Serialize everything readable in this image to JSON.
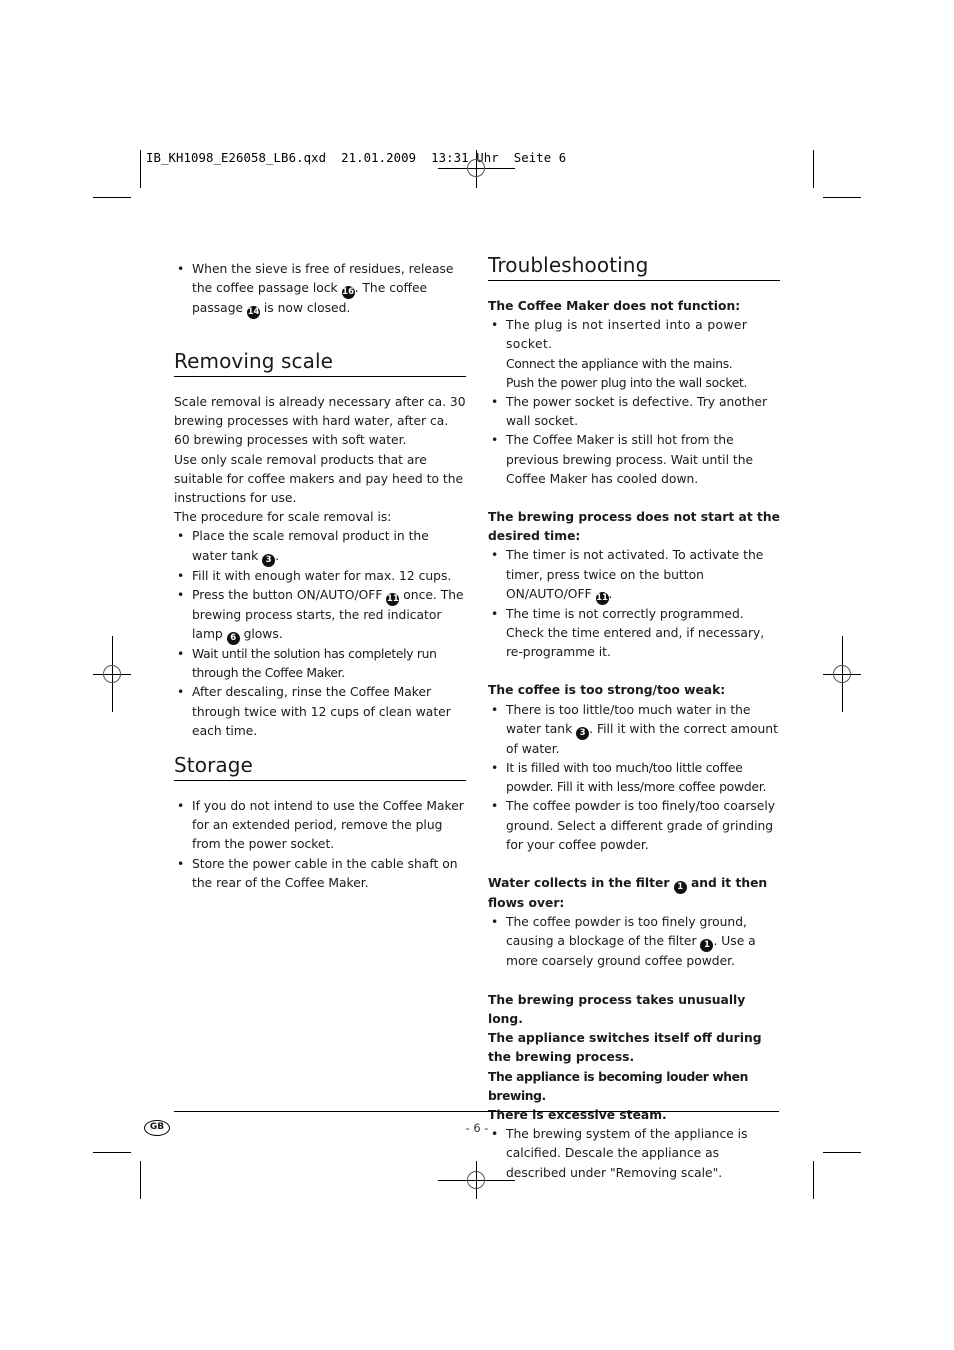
{
  "slug": {
    "file": "IB_KH1098_E26058_LB6.qxd",
    "date": "21.01.2009",
    "time": "13:31 Uhr",
    "page": "Seite 6"
  },
  "left_column": {
    "intro_bullet": {
      "t1": "When the sieve is free of residues, release the coffee passage lock ",
      "ref1": "16",
      "t2": ". The coffee passage ",
      "ref2": "14",
      "t3": " is now closed."
    },
    "removing_scale": {
      "heading": "Removing scale",
      "para1": "Scale removal is already necessary after ca. 30 brewing processes with hard water, after ca. 60 brewing processes with soft water.",
      "para2": "Use only scale removal products that are suitable for coffee makers and pay heed to the instructions for use.",
      "para3": "The procedure for scale removal is:",
      "b1_t1": "Place the scale removal product in the water tank ",
      "b1_ref": "3",
      "b1_t2": ".",
      "b2": "Fill it with enough water for max. 12 cups.",
      "b3_t1": "Press the button ON/AUTO/OFF ",
      "b3_ref": "11",
      "b3_t2": " once. The brewing process starts, the red indicator lamp ",
      "b3_ref2": "6",
      "b3_t3": " glows.",
      "b4": "Wait until the solution has completely run through the Coffee Maker.",
      "b5": "After descaling, rinse the Coffee Maker through twice with 12 cups of clean water each time."
    },
    "storage": {
      "heading": "Storage",
      "b1": "If you do not intend to use the Coffee Maker for an extended period, remove the plug from the power socket.",
      "b2": "Store the power cable in the cable shaft on the rear of the Coffee Maker."
    }
  },
  "right_column": {
    "heading": "Troubleshooting",
    "s1": {
      "title": "The Coffee Maker does not function:",
      "b1_l1": "The plug is not inserted into a power socket.",
      "b1_l2": "Connect the appliance with the mains.",
      "b1_l3": "Push the power plug into the wall socket.",
      "b2": "The power socket is defective. Try another wall socket.",
      "b3": "The Coffee Maker is still hot from the previous brewing process. Wait until the Coffee Maker has cooled down."
    },
    "s2": {
      "title": "The brewing process does not start at the desired time:",
      "b1_t1": "The timer is not activated. To activate the timer, press twice on the button ON/AUTO/OFF ",
      "b1_ref": "11",
      "b1_t2": ".",
      "b2": "The time is not correctly programmed. Check the time entered and, if necessary, re-programme it."
    },
    "s3": {
      "title": "The coffee is too strong/too weak:",
      "b1_t1": "There is too little/too much water in the water tank ",
      "b1_ref": "3",
      "b1_t2": ". Fill it with the correct amount of water.",
      "b2": "It is filled with too much/too little coffee powder. Fill it with less/more coffee powder.",
      "b3": "The coffee powder is too finely/too coarsely ground. Select a different grade of grinding for your coffee powder."
    },
    "s4": {
      "title_t1": "Water collects in the filter ",
      "title_ref": "1",
      "title_t2": " and it then flows over:",
      "b1_t1": "The coffee powder is too finely ground, causing a blockage of the filter ",
      "b1_ref": "1",
      "b1_t2": ". Use a more coarsely ground coffee powder."
    },
    "s5": {
      "title_l1": "The brewing process takes unusually long.",
      "title_l2": "The appliance switches itself off during the brewing process.",
      "title_l3": "The appliance is becoming louder when brewing.",
      "title_l4": "There is excessive steam.",
      "b1": "The brewing system of the appliance is calcified. Descale the appliance as described under \"Removing scale\"."
    }
  },
  "footer": {
    "language_badge": "GB",
    "page_number": "- 6 -"
  }
}
